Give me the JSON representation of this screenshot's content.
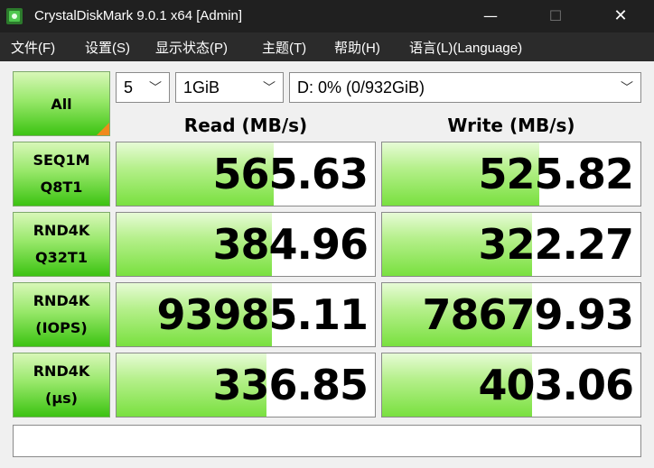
{
  "window": {
    "title": "CrystalDiskMark 9.0.1 x64 [Admin]",
    "minimize": "—",
    "maximize": "☐",
    "close": "✕"
  },
  "menu": [
    "文件(F)",
    "设置(S)",
    "显示状态(P)",
    "主题(T)",
    "帮助(H)",
    "语言(L)(Language)"
  ],
  "controls": {
    "all_label": "All",
    "count": "5",
    "size": "1GiB",
    "drive": "D: 0% (0/932GiB)"
  },
  "headers": {
    "read": "Read (MB/s)",
    "write": "Write (MB/s)"
  },
  "rows": [
    {
      "line1": "SEQ1M",
      "line2": "Q8T1",
      "read": "565.63",
      "write": "525.82",
      "read_fill": 0.61,
      "write_fill": 0.61
    },
    {
      "line1": "RND4K",
      "line2": "Q32T1",
      "read": "384.96",
      "write": "322.27",
      "read_fill": 0.6,
      "write_fill": 0.58
    },
    {
      "line1": "RND4K",
      "line2": "(IOPS)",
      "read": "93985.11",
      "write": "78679.93",
      "read_fill": 0.6,
      "write_fill": 0.58
    },
    {
      "line1": "RND4K",
      "line2": "(μs)",
      "read": "336.85",
      "write": "403.06",
      "read_fill": 0.58,
      "write_fill": 0.58
    }
  ],
  "colors": {
    "accent_green": "#3cc312",
    "corner_orange": "#f08a1c",
    "titlebar": "#202020",
    "menubar": "#2b2b2b"
  },
  "icons": {
    "app": "crystaldiskmark-icon"
  }
}
